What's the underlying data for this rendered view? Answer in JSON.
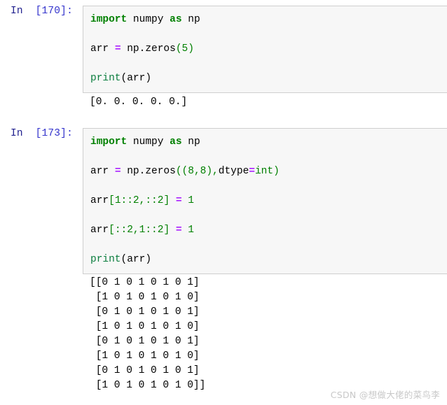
{
  "app": {
    "name": "jupyter-notebook",
    "background": "#ffffff",
    "cell_background": "#f7f7f7",
    "cell_border": "#cfcfcf",
    "prompt_color": "#2b2bd0",
    "keyword_color": "#008000",
    "operator_color": "#aa22ff",
    "builtin_color": "#0b7d3e"
  },
  "cells": [
    {
      "prompt_in": "In",
      "prompt_index": "[170]:",
      "code_lines": [
        [
          {
            "t": "import",
            "c": "kw"
          },
          {
            "t": " numpy ",
            "c": "plain"
          },
          {
            "t": "as",
            "c": "kw"
          },
          {
            "t": " np",
            "c": "plain"
          }
        ],
        [
          {
            "t": "arr ",
            "c": "plain"
          },
          {
            "t": "=",
            "c": "op"
          },
          {
            "t": " np.zeros",
            "c": "plain"
          },
          {
            "t": "(",
            "c": "punc"
          },
          {
            "t": "5",
            "c": "num"
          },
          {
            "t": ")",
            "c": "punc"
          }
        ],
        [
          {
            "t": "print",
            "c": "fn"
          },
          {
            "t": "(arr)",
            "c": "plain"
          }
        ]
      ],
      "code_text": "import numpy as np\n\narr = np.zeros(5)\n\nprint(arr)",
      "output_lines": [
        "[0. 0. 0. 0. 0.]"
      ]
    },
    {
      "prompt_in": "In",
      "prompt_index": "[173]:",
      "code_lines": [
        [
          {
            "t": "import",
            "c": "kw"
          },
          {
            "t": " numpy ",
            "c": "plain"
          },
          {
            "t": "as",
            "c": "kw"
          },
          {
            "t": " np",
            "c": "plain"
          }
        ],
        [
          {
            "t": "arr ",
            "c": "plain"
          },
          {
            "t": "=",
            "c": "op"
          },
          {
            "t": " np.zeros",
            "c": "plain"
          },
          {
            "t": "((",
            "c": "punc"
          },
          {
            "t": "8",
            "c": "num"
          },
          {
            "t": ",",
            "c": "punc"
          },
          {
            "t": "8",
            "c": "num"
          },
          {
            "t": "),",
            "c": "punc"
          },
          {
            "t": "dtype",
            "c": "plain"
          },
          {
            "t": "=",
            "c": "op"
          },
          {
            "t": "int",
            "c": "builtin"
          },
          {
            "t": ")",
            "c": "punc"
          }
        ],
        [
          {
            "t": "arr",
            "c": "plain"
          },
          {
            "t": "[",
            "c": "punc"
          },
          {
            "t": "1",
            "c": "num"
          },
          {
            "t": "::",
            "c": "punc"
          },
          {
            "t": "2",
            "c": "num"
          },
          {
            "t": ",",
            "c": "punc"
          },
          {
            "t": "::",
            "c": "punc"
          },
          {
            "t": "2",
            "c": "num"
          },
          {
            "t": "]",
            "c": "punc"
          },
          {
            "t": " ",
            "c": "plain"
          },
          {
            "t": "=",
            "c": "op"
          },
          {
            "t": " ",
            "c": "plain"
          },
          {
            "t": "1",
            "c": "num"
          }
        ],
        [
          {
            "t": "arr",
            "c": "plain"
          },
          {
            "t": "[",
            "c": "punc"
          },
          {
            "t": "::",
            "c": "punc"
          },
          {
            "t": "2",
            "c": "num"
          },
          {
            "t": ",",
            "c": "punc"
          },
          {
            "t": "1",
            "c": "num"
          },
          {
            "t": "::",
            "c": "punc"
          },
          {
            "t": "2",
            "c": "num"
          },
          {
            "t": "]",
            "c": "punc"
          },
          {
            "t": " ",
            "c": "plain"
          },
          {
            "t": "=",
            "c": "op"
          },
          {
            "t": " ",
            "c": "plain"
          },
          {
            "t": "1",
            "c": "num"
          }
        ],
        [
          {
            "t": "print",
            "c": "fn"
          },
          {
            "t": "(arr)",
            "c": "plain"
          }
        ]
      ],
      "code_text": "import numpy as np\n\narr = np.zeros((8,8),dtype=int)\n\narr[1::2,::2] = 1\n\narr[::2,1::2] = 1\n\nprint(arr)",
      "output_lines": [
        "[[0 1 0 1 0 1 0 1]",
        " [1 0 1 0 1 0 1 0]",
        " [0 1 0 1 0 1 0 1]",
        " [1 0 1 0 1 0 1 0]",
        " [0 1 0 1 0 1 0 1]",
        " [1 0 1 0 1 0 1 0]",
        " [0 1 0 1 0 1 0 1]",
        " [1 0 1 0 1 0 1 0]]"
      ]
    }
  ],
  "watermark": {
    "text": "CSDN @想做大佬的菜鸟李"
  }
}
